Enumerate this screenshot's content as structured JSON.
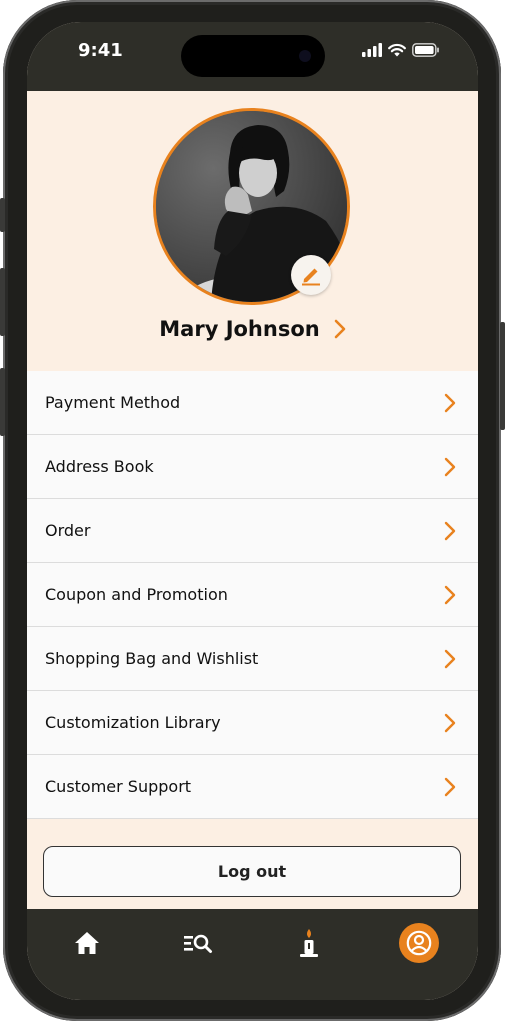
{
  "status_bar": {
    "time": "9:41"
  },
  "profile": {
    "name": "Mary Johnson"
  },
  "menu": {
    "items": [
      {
        "label": "Payment Method"
      },
      {
        "label": "Address Book"
      },
      {
        "label": "Order"
      },
      {
        "label": "Coupon and Promotion"
      },
      {
        "label": "Shopping Bag and Wishlist"
      },
      {
        "label": "Customization Library"
      },
      {
        "label": "Customer Support"
      }
    ]
  },
  "logout": {
    "label": "Log out"
  },
  "tab_bar": {
    "tabs": [
      {
        "icon": "home-icon"
      },
      {
        "icon": "search-list-icon"
      },
      {
        "icon": "candle-icon"
      },
      {
        "icon": "profile-icon",
        "active": true
      }
    ]
  },
  "colors": {
    "accent": "#E8821E",
    "header_bg": "#2E2E28",
    "profile_bg": "#FCEFE3"
  }
}
